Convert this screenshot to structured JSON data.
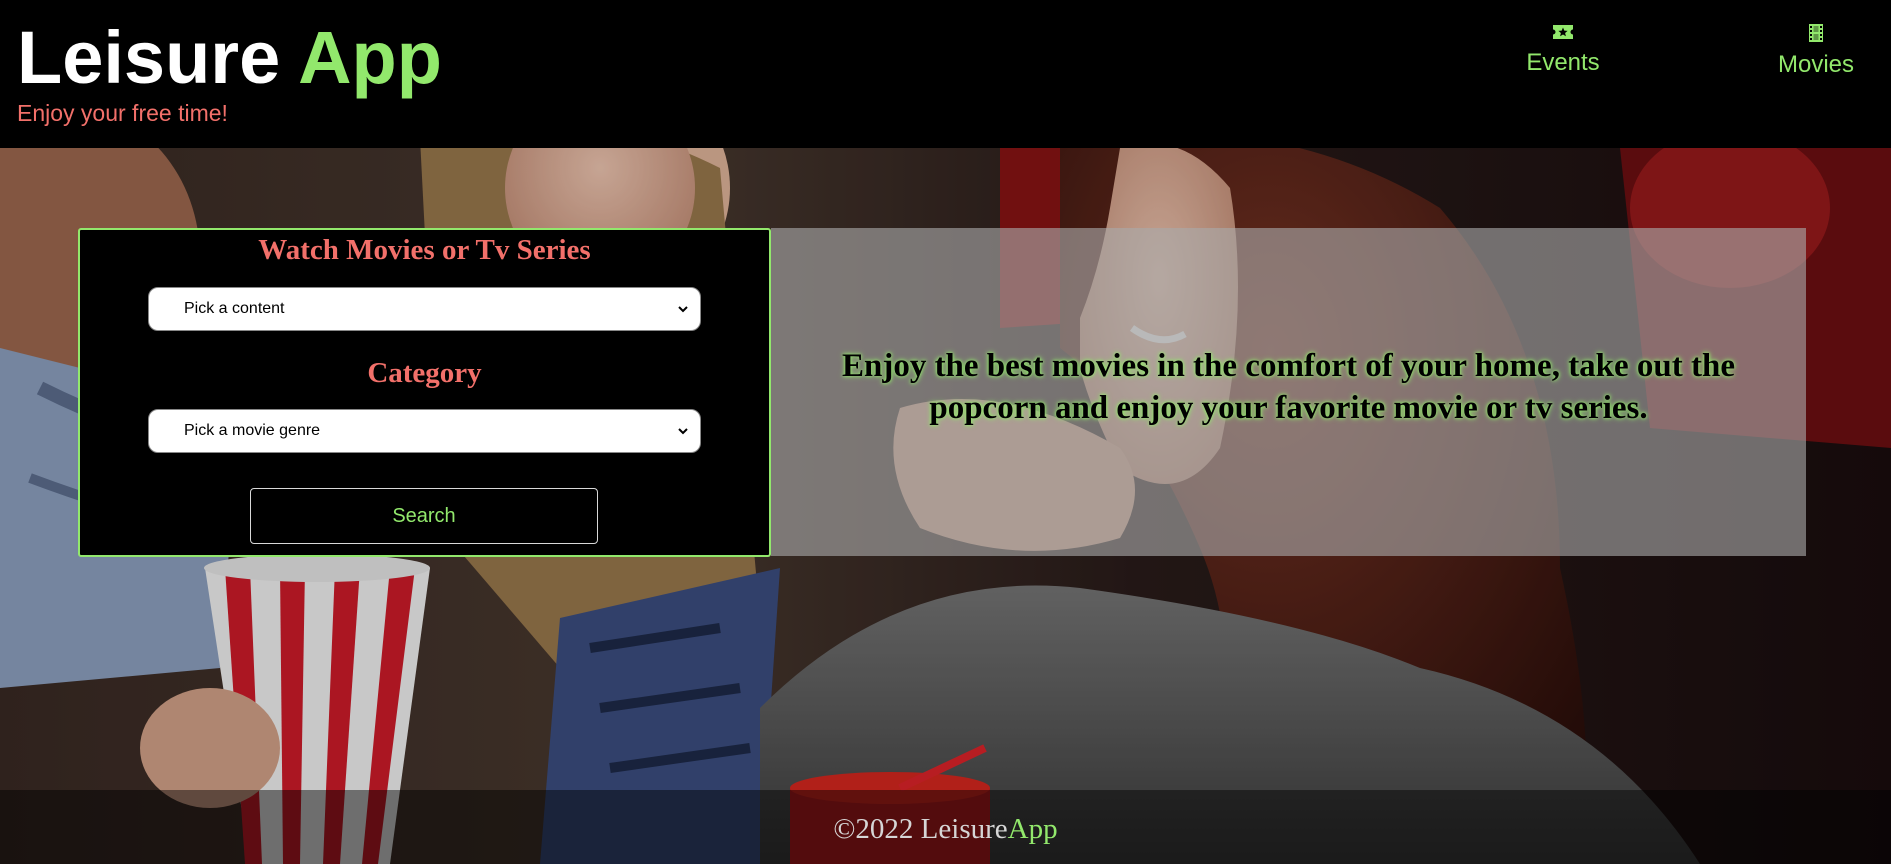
{
  "header": {
    "title_main": "Leisure",
    "title_accent": "App",
    "tagline": "Enjoy your free time!",
    "nav": [
      {
        "label": "Events",
        "icon": "ticket-icon"
      },
      {
        "label": "Movies",
        "icon": "film-icon"
      }
    ]
  },
  "search": {
    "heading_content": "Watch Movies or Tv Series",
    "content_select_value": "Pick a content",
    "heading_category": "Category",
    "genre_select_value": "Pick a movie genre",
    "button_label": "Search"
  },
  "promo": {
    "text": "Enjoy the best movies in the comfort of your home, take out the popcorn and enjoy your favorite movie or tv series."
  },
  "footer": {
    "copyright": "©2022 Leisure",
    "brand_accent": "App"
  },
  "colors": {
    "accent_green": "#92e86c",
    "accent_coral": "#f2706a",
    "background": "#000000"
  }
}
